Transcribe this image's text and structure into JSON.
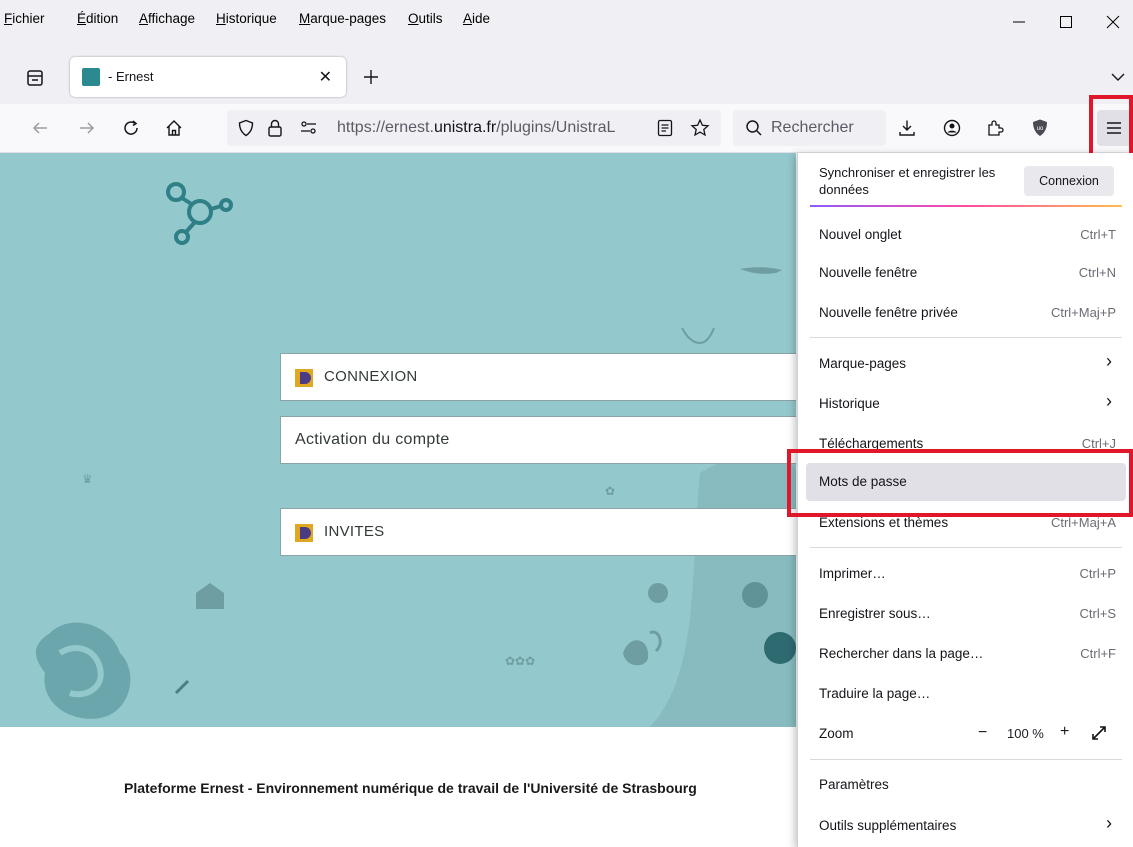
{
  "menubar": {
    "items": [
      "Fichier",
      "Édition",
      "Affichage",
      "Historique",
      "Marque-pages",
      "Outils",
      "Aide"
    ]
  },
  "tab": {
    "title": "- Ernest"
  },
  "navbar": {
    "url_prefix": "https://ernest.",
    "url_domain": "unistra.fr",
    "url_path": "/plugins/UnistraL",
    "search_placeholder": "Rechercher"
  },
  "page": {
    "connexion_label": "CONNEXION",
    "activation_label": "Activation du compte",
    "invites_label": "INVITES",
    "footer": "Plateforme Ernest - Environnement numérique de travail de l'Université de Strasbourg"
  },
  "appmenu": {
    "sync_label": "Synchroniser et enregistrer les données",
    "connexion_button": "Connexion",
    "items": [
      {
        "label": "Nouvel onglet",
        "shortcut": "Ctrl+T"
      },
      {
        "label": "Nouvelle fenêtre",
        "shortcut": "Ctrl+N"
      },
      {
        "label": "Nouvelle fenêtre privée",
        "shortcut": "Ctrl+Maj+P"
      },
      {
        "label": "Marque-pages",
        "shortcut": ""
      },
      {
        "label": "Historique",
        "shortcut": ""
      },
      {
        "label": "Téléchargements",
        "shortcut": "Ctrl+J"
      },
      {
        "label": "Mots de passe",
        "shortcut": ""
      },
      {
        "label": "Extensions et thèmes",
        "shortcut": "Ctrl+Maj+A"
      },
      {
        "label": "Imprimer…",
        "shortcut": "Ctrl+P"
      },
      {
        "label": "Enregistrer sous…",
        "shortcut": "Ctrl+S"
      },
      {
        "label": "Rechercher dans la page…",
        "shortcut": "Ctrl+F"
      },
      {
        "label": "Traduire la page…",
        "shortcut": ""
      },
      {
        "label": "Zoom",
        "shortcut": ""
      },
      {
        "label": "Paramètres",
        "shortcut": ""
      },
      {
        "label": "Outils supplémentaires",
        "shortcut": ""
      }
    ],
    "zoom_value": "100 %"
  },
  "colors": {
    "hero_bg": "#93c8cc",
    "highlight_red": "#e0172b"
  }
}
